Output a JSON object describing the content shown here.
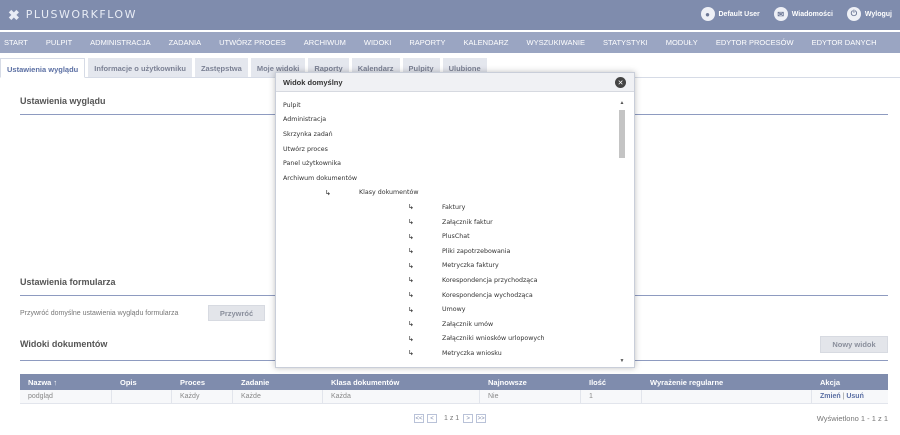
{
  "topbar": {
    "logo_icon": "close-x-icon",
    "logo_text": "PLUSWORKFLOW",
    "user_label": "Default User",
    "messages_label": "Wiadomości",
    "logout_label": "Wyloguj"
  },
  "nav": {
    "items": [
      "START",
      "PULPIT",
      "ADMINISTRACJA",
      "ZADANIA",
      "UTWÓRZ PROCES",
      "ARCHIWUM",
      "WIDOKI",
      "RAPORTY",
      "KALENDARZ",
      "WYSZUKIWANIE",
      "STATYSTYKI",
      "MODUŁY",
      "EDYTOR PROCESÓW",
      "EDYTOR DANYCH"
    ]
  },
  "tabs": {
    "items": [
      "Ustawienia wyglądu",
      "Informacje o użytkowniku",
      "Zastępstwa",
      "Moje widoki",
      "Raporty",
      "Kalendarz",
      "Pulpity",
      "Ulubione"
    ]
  },
  "sections": {
    "appearance_title": "Ustawienia wyglądu",
    "form_title": "Ustawienia formularza",
    "restore_label": "Przywróć domyślne ustawienia wyglądu formularza",
    "restore_button": "Przywróć",
    "views_title": "Widoki dokumentów",
    "new_view_button": "Nowy widok"
  },
  "grid": {
    "headers": [
      "Nazwa ↑",
      "Opis",
      "Proces",
      "Zadanie",
      "Klasa dokumentów",
      "Najnowsze",
      "Ilość",
      "Wyrażenie regularne",
      "Akcja"
    ],
    "row": [
      "podgląd",
      "",
      "Każdy",
      "Każde",
      "Każda",
      "Nie",
      "1",
      ""
    ],
    "action_edit": "Zmień",
    "action_sep": "|",
    "action_delete": "Usuń"
  },
  "pager": {
    "first": "<<",
    "prev": "<",
    "text": "1 z 1",
    "next": ">",
    "last": ">>",
    "info": "Wyświetlono 1 - 1 z 1"
  },
  "modal": {
    "title": "Widok domyślny",
    "close_icon": "close-circle-icon",
    "tree": [
      {
        "label": "Pulpit",
        "level": 0
      },
      {
        "label": "Administracja",
        "level": 0
      },
      {
        "label": "Skrzynka zadań",
        "level": 0
      },
      {
        "label": "Utwórz proces",
        "level": 0
      },
      {
        "label": "Panel użytkownika",
        "level": 0
      },
      {
        "label": "Archiwum dokumentów",
        "level": 0
      },
      {
        "label": "Klasy dokumentów",
        "level": 1
      },
      {
        "label": "Faktury",
        "level": 2
      },
      {
        "label": "Załącznik faktur",
        "level": 2
      },
      {
        "label": "PlusChat",
        "level": 2
      },
      {
        "label": "Pliki zapotrzebowania",
        "level": 2
      },
      {
        "label": "Metryczka faktury",
        "level": 2
      },
      {
        "label": "Korespondencja przychodząca",
        "level": 2
      },
      {
        "label": "Korespondencja wychodząca",
        "level": 2
      },
      {
        "label": "Umowy",
        "level": 2
      },
      {
        "label": "Załącznik umów",
        "level": 2
      },
      {
        "label": "Załączniki wniosków urlopowych",
        "level": 2
      },
      {
        "label": "Metryczka wniosku",
        "level": 2
      }
    ]
  }
}
